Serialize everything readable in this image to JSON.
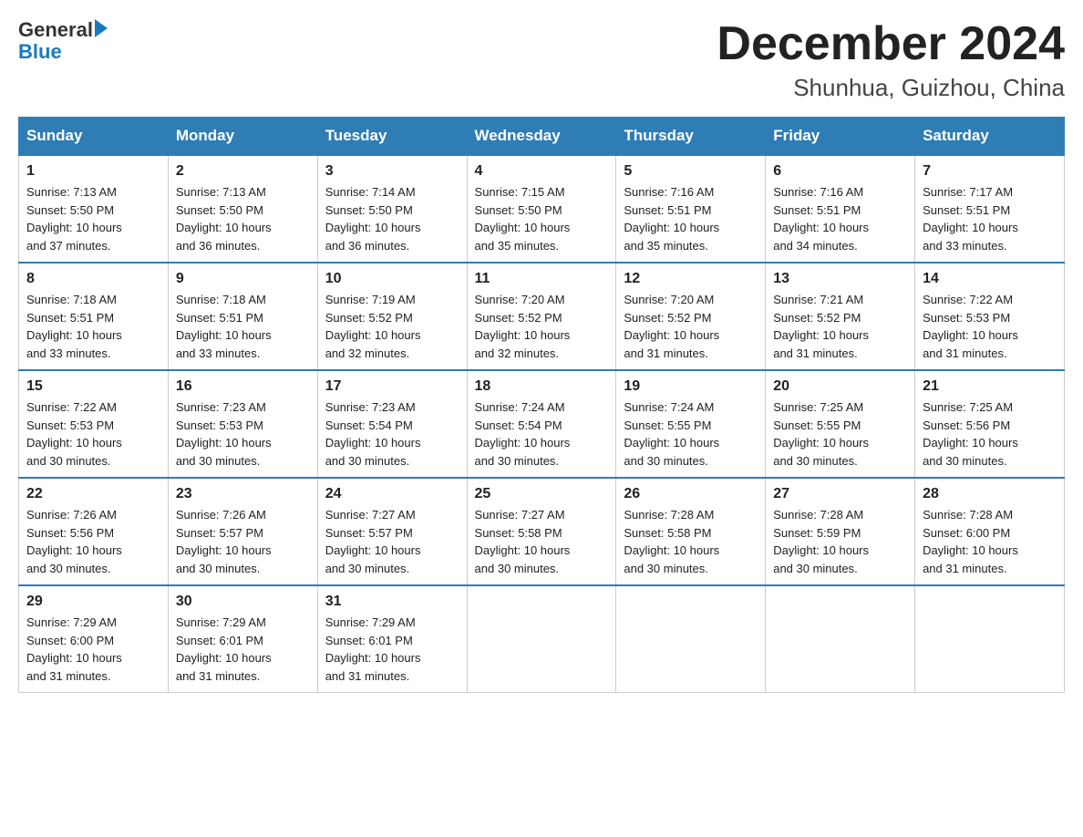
{
  "logo": {
    "text_general": "General",
    "arrow": "▶",
    "text_blue": "Blue"
  },
  "title": {
    "month_year": "December 2024",
    "location": "Shunhua, Guizhou, China"
  },
  "days_of_week": [
    "Sunday",
    "Monday",
    "Tuesday",
    "Wednesday",
    "Thursday",
    "Friday",
    "Saturday"
  ],
  "weeks": [
    [
      {
        "day": "1",
        "sunrise": "Sunrise: 7:13 AM",
        "sunset": "Sunset: 5:50 PM",
        "daylight": "Daylight: 10 hours and 37 minutes."
      },
      {
        "day": "2",
        "sunrise": "Sunrise: 7:13 AM",
        "sunset": "Sunset: 5:50 PM",
        "daylight": "Daylight: 10 hours and 36 minutes."
      },
      {
        "day": "3",
        "sunrise": "Sunrise: 7:14 AM",
        "sunset": "Sunset: 5:50 PM",
        "daylight": "Daylight: 10 hours and 36 minutes."
      },
      {
        "day": "4",
        "sunrise": "Sunrise: 7:15 AM",
        "sunset": "Sunset: 5:50 PM",
        "daylight": "Daylight: 10 hours and 35 minutes."
      },
      {
        "day": "5",
        "sunrise": "Sunrise: 7:16 AM",
        "sunset": "Sunset: 5:51 PM",
        "daylight": "Daylight: 10 hours and 35 minutes."
      },
      {
        "day": "6",
        "sunrise": "Sunrise: 7:16 AM",
        "sunset": "Sunset: 5:51 PM",
        "daylight": "Daylight: 10 hours and 34 minutes."
      },
      {
        "day": "7",
        "sunrise": "Sunrise: 7:17 AM",
        "sunset": "Sunset: 5:51 PM",
        "daylight": "Daylight: 10 hours and 33 minutes."
      }
    ],
    [
      {
        "day": "8",
        "sunrise": "Sunrise: 7:18 AM",
        "sunset": "Sunset: 5:51 PM",
        "daylight": "Daylight: 10 hours and 33 minutes."
      },
      {
        "day": "9",
        "sunrise": "Sunrise: 7:18 AM",
        "sunset": "Sunset: 5:51 PM",
        "daylight": "Daylight: 10 hours and 33 minutes."
      },
      {
        "day": "10",
        "sunrise": "Sunrise: 7:19 AM",
        "sunset": "Sunset: 5:52 PM",
        "daylight": "Daylight: 10 hours and 32 minutes."
      },
      {
        "day": "11",
        "sunrise": "Sunrise: 7:20 AM",
        "sunset": "Sunset: 5:52 PM",
        "daylight": "Daylight: 10 hours and 32 minutes."
      },
      {
        "day": "12",
        "sunrise": "Sunrise: 7:20 AM",
        "sunset": "Sunset: 5:52 PM",
        "daylight": "Daylight: 10 hours and 31 minutes."
      },
      {
        "day": "13",
        "sunrise": "Sunrise: 7:21 AM",
        "sunset": "Sunset: 5:52 PM",
        "daylight": "Daylight: 10 hours and 31 minutes."
      },
      {
        "day": "14",
        "sunrise": "Sunrise: 7:22 AM",
        "sunset": "Sunset: 5:53 PM",
        "daylight": "Daylight: 10 hours and 31 minutes."
      }
    ],
    [
      {
        "day": "15",
        "sunrise": "Sunrise: 7:22 AM",
        "sunset": "Sunset: 5:53 PM",
        "daylight": "Daylight: 10 hours and 30 minutes."
      },
      {
        "day": "16",
        "sunrise": "Sunrise: 7:23 AM",
        "sunset": "Sunset: 5:53 PM",
        "daylight": "Daylight: 10 hours and 30 minutes."
      },
      {
        "day": "17",
        "sunrise": "Sunrise: 7:23 AM",
        "sunset": "Sunset: 5:54 PM",
        "daylight": "Daylight: 10 hours and 30 minutes."
      },
      {
        "day": "18",
        "sunrise": "Sunrise: 7:24 AM",
        "sunset": "Sunset: 5:54 PM",
        "daylight": "Daylight: 10 hours and 30 minutes."
      },
      {
        "day": "19",
        "sunrise": "Sunrise: 7:24 AM",
        "sunset": "Sunset: 5:55 PM",
        "daylight": "Daylight: 10 hours and 30 minutes."
      },
      {
        "day": "20",
        "sunrise": "Sunrise: 7:25 AM",
        "sunset": "Sunset: 5:55 PM",
        "daylight": "Daylight: 10 hours and 30 minutes."
      },
      {
        "day": "21",
        "sunrise": "Sunrise: 7:25 AM",
        "sunset": "Sunset: 5:56 PM",
        "daylight": "Daylight: 10 hours and 30 minutes."
      }
    ],
    [
      {
        "day": "22",
        "sunrise": "Sunrise: 7:26 AM",
        "sunset": "Sunset: 5:56 PM",
        "daylight": "Daylight: 10 hours and 30 minutes."
      },
      {
        "day": "23",
        "sunrise": "Sunrise: 7:26 AM",
        "sunset": "Sunset: 5:57 PM",
        "daylight": "Daylight: 10 hours and 30 minutes."
      },
      {
        "day": "24",
        "sunrise": "Sunrise: 7:27 AM",
        "sunset": "Sunset: 5:57 PM",
        "daylight": "Daylight: 10 hours and 30 minutes."
      },
      {
        "day": "25",
        "sunrise": "Sunrise: 7:27 AM",
        "sunset": "Sunset: 5:58 PM",
        "daylight": "Daylight: 10 hours and 30 minutes."
      },
      {
        "day": "26",
        "sunrise": "Sunrise: 7:28 AM",
        "sunset": "Sunset: 5:58 PM",
        "daylight": "Daylight: 10 hours and 30 minutes."
      },
      {
        "day": "27",
        "sunrise": "Sunrise: 7:28 AM",
        "sunset": "Sunset: 5:59 PM",
        "daylight": "Daylight: 10 hours and 30 minutes."
      },
      {
        "day": "28",
        "sunrise": "Sunrise: 7:28 AM",
        "sunset": "Sunset: 6:00 PM",
        "daylight": "Daylight: 10 hours and 31 minutes."
      }
    ],
    [
      {
        "day": "29",
        "sunrise": "Sunrise: 7:29 AM",
        "sunset": "Sunset: 6:00 PM",
        "daylight": "Daylight: 10 hours and 31 minutes."
      },
      {
        "day": "30",
        "sunrise": "Sunrise: 7:29 AM",
        "sunset": "Sunset: 6:01 PM",
        "daylight": "Daylight: 10 hours and 31 minutes."
      },
      {
        "day": "31",
        "sunrise": "Sunrise: 7:29 AM",
        "sunset": "Sunset: 6:01 PM",
        "daylight": "Daylight: 10 hours and 31 minutes."
      },
      null,
      null,
      null,
      null
    ]
  ]
}
